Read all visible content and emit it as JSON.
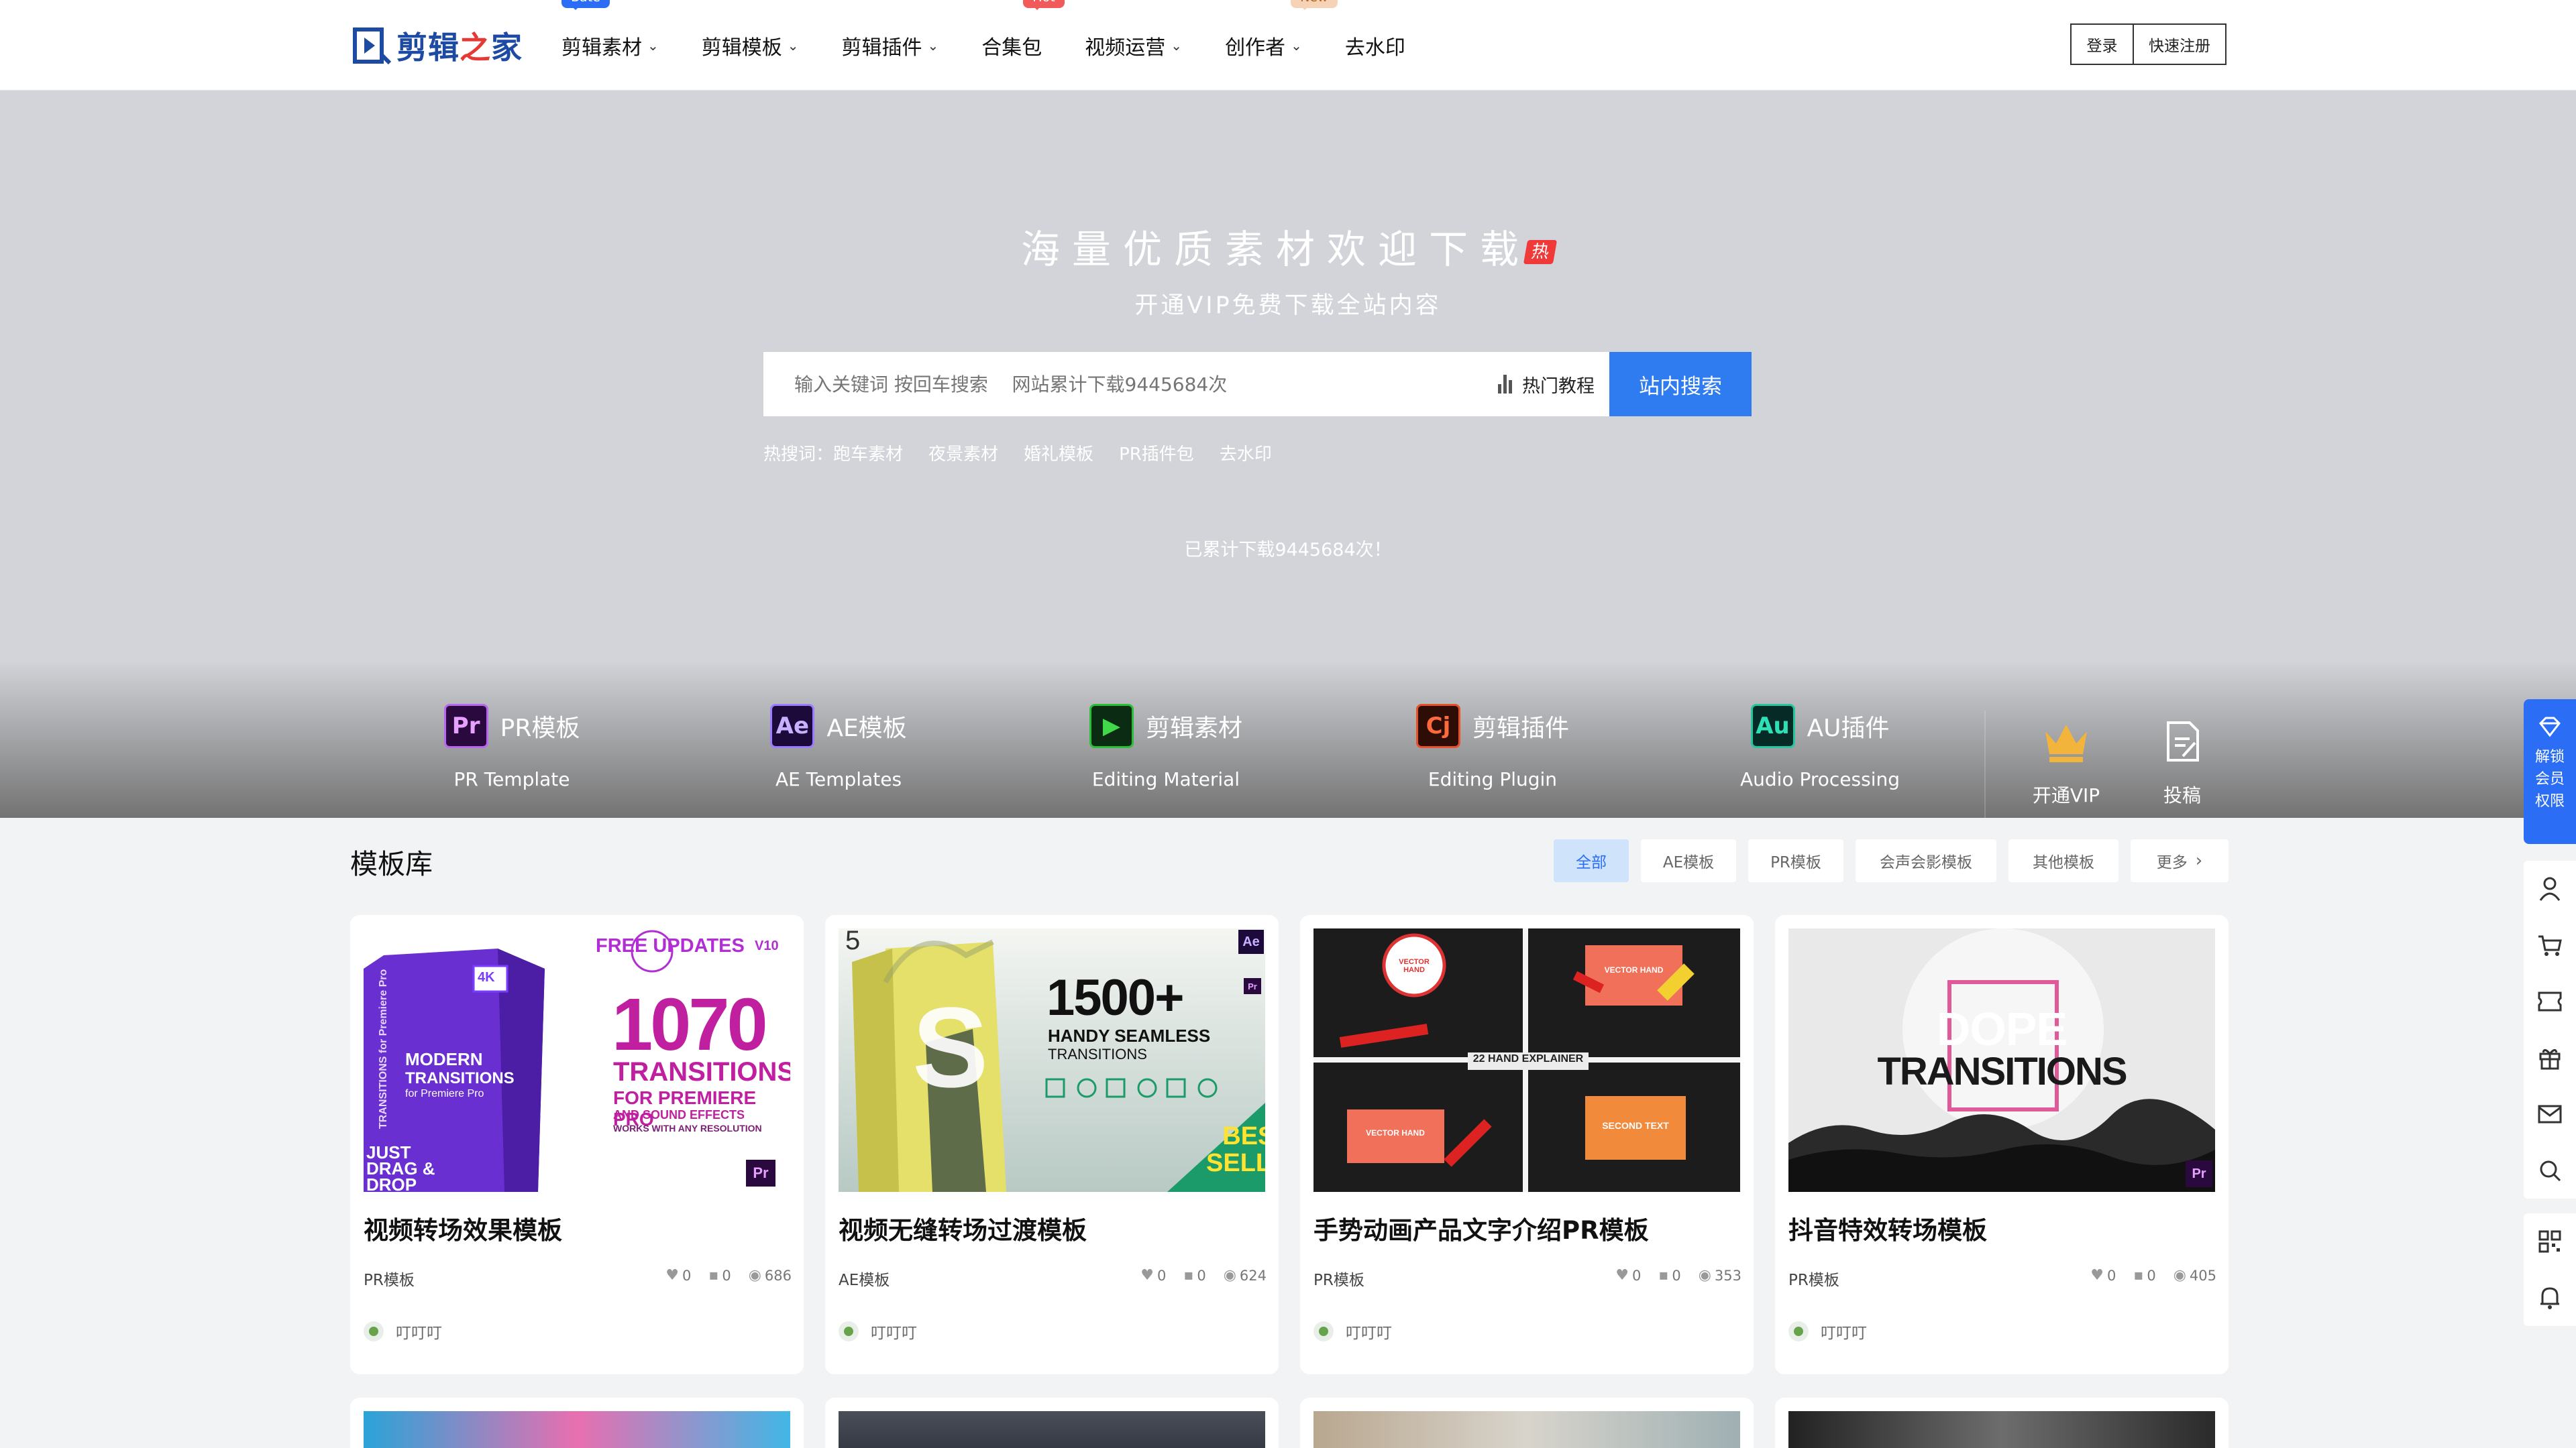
{
  "header": {
    "logo_text": "剪辑",
    "logo_text_accent": "之",
    "logo_text_tail": "家",
    "nav": [
      {
        "label": "剪辑素材",
        "dropdown": true,
        "badge": "Bate",
        "badge_color": "#2b6ef5"
      },
      {
        "label": "剪辑模板",
        "dropdown": true
      },
      {
        "label": "剪辑插件",
        "dropdown": true
      },
      {
        "label": "合集包",
        "dropdown": false,
        "badge": "Hot",
        "badge_color": "#f05a5a"
      },
      {
        "label": "视频运营",
        "dropdown": true
      },
      {
        "label": "创作者",
        "dropdown": true,
        "badge": "New",
        "badge_color": "#f6d2b6"
      },
      {
        "label": "去水印",
        "dropdown": false
      }
    ],
    "login": "登录",
    "register": "快速注册"
  },
  "hero": {
    "title": "海量优质素材欢迎下载",
    "hot_tag": "热",
    "subtitle": "开通VIP免费下载全站内容",
    "search_placeholder": "输入关键词 按回车搜索    网站累计下载9445684次",
    "hot_tutorial": "热门教程",
    "search_button": "站内搜索",
    "hot_label": "热搜词：",
    "hot_words": [
      "跑车素材",
      "夜景素材",
      "婚礼模板",
      "PR插件包",
      "去水印"
    ],
    "counter": "已累计下载9445684次！"
  },
  "categories": [
    {
      "icon": "Pr",
      "label": "PR模板",
      "sub": "PR Template",
      "icon_bg": "#2a0a3e",
      "icon_fg": "#e8a0ff"
    },
    {
      "icon": "Ae",
      "label": "AE模板",
      "sub": "AE Templates",
      "icon_bg": "#1c0a3a",
      "icon_fg": "#c9b0ff"
    },
    {
      "icon": "▶",
      "label": "剪辑素材",
      "sub": "Editing Material",
      "icon_bg": "#0b2b12",
      "icon_fg": "#3fd94a"
    },
    {
      "icon": "Cj",
      "label": "剪辑插件",
      "sub": "Editing Plugin",
      "icon_bg": "#2e0d06",
      "icon_fg": "#ff6a3d"
    },
    {
      "icon": "Au",
      "label": "AU插件",
      "sub": "Audio Processing",
      "icon_bg": "#062a25",
      "icon_fg": "#2fe0b6"
    }
  ],
  "quick": {
    "vip": "开通VIP",
    "submit": "投稿"
  },
  "section": {
    "title": "模板库",
    "filters": [
      "全部",
      "AE模板",
      "PR模板",
      "会声会影模板",
      "其他模板",
      "更多"
    ]
  },
  "cards": [
    {
      "title": "视频转场效果模板",
      "category": "PR模板",
      "likes": "0",
      "comments": "0",
      "views": "686",
      "author": "叮叮叮",
      "thumb": {
        "badge": "FREE UPDATES",
        "version": "V10",
        "big": "1070",
        "line1": "TRANSITIONS",
        "line2": "FOR PREMIERE PRO",
        "line3": "AND SOUND EFFECTS",
        "line4": "WORKS WITH ANY RESOLUTION",
        "box1": "MODERN",
        "box2": "TRANSITIONS",
        "box3": "for Premiere Pro",
        "box4": "4K",
        "side": "TRANSITIONS for Premiere Pro",
        "corner1": "JUST",
        "corner2": "DRAG &",
        "corner3": "DROP",
        "tag": "Pr"
      }
    },
    {
      "title": "视频无缝转场过渡模板",
      "category": "AE模板",
      "likes": "0",
      "comments": "0",
      "views": "624",
      "author": "叮叮叮",
      "thumb": {
        "num": "5",
        "big": "1500+",
        "line1": "HANDY SEAMLESS",
        "line2": "TRANSITIONS",
        "letter": "S",
        "best1": "BEST",
        "best2": "SELLER",
        "tag": "Ae",
        "tag2": "Pr"
      }
    },
    {
      "title": "手势动画产品文字介绍PR模板",
      "category": "PR模板",
      "likes": "0",
      "comments": "0",
      "views": "353",
      "author": "叮叮叮",
      "thumb": {
        "center": "22 HAND EXPLAINER",
        "tl": "VECTOR HAND",
        "tr": "VECTOR HAND",
        "bl": "VECTOR HAND",
        "br": "SECOND TEXT"
      }
    },
    {
      "title": "抖音特效转场模板",
      "category": "PR模板",
      "likes": "0",
      "comments": "0",
      "views": "405",
      "author": "叮叮叮",
      "thumb": {
        "line1": "DOPE",
        "line2": "TRANSITIONS",
        "tag": "Pr"
      }
    }
  ],
  "sidebar": {
    "vip_line1": "解锁",
    "vip_line2": "会员",
    "vip_line3": "权限"
  }
}
